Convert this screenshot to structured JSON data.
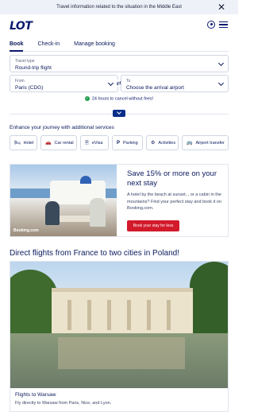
{
  "banner": {
    "message": "Travel information related to the situation in the Middle East",
    "close": "✕"
  },
  "header": {
    "logo": "LOT"
  },
  "tabs": [
    "Book",
    "Check-in",
    "Manage booking"
  ],
  "form": {
    "travel_type": {
      "label": "Travel type",
      "value": "Round-trip flight"
    },
    "from": {
      "label": "From",
      "value": "Paris (CDG)"
    },
    "to": {
      "label": "To",
      "value": "Choose the arrival airport"
    },
    "swap": "⇄",
    "cancel_note": "24 hours to cancel without fees!"
  },
  "services": {
    "heading": "Enhance your journey with additional services",
    "items": [
      {
        "icon": "🛏",
        "label": "Hotel"
      },
      {
        "icon": "🚗",
        "label": "Car rental"
      },
      {
        "icon": "🗎",
        "label": "eVisa"
      },
      {
        "icon": "P",
        "label": "Parking"
      },
      {
        "icon": "⚙",
        "label": "Activities"
      },
      {
        "icon": "🚌",
        "label": "Airport transfer"
      }
    ]
  },
  "promo": {
    "title": "Save 15% or more on your next stay",
    "description": "A hotel by the beach at sunset, , or a cabin in the mountains? Find your perfect stay and book it on Booking.com.",
    "button": "Book your stay for less",
    "image_credit": "Booking.com"
  },
  "direct": {
    "heading": "Direct flights from France to two cities in Poland!",
    "card_title": "Flights to Warsaw",
    "card_desc": "Fly directly to Warsaw from Paris, Nice, and Lyon."
  },
  "colors": {
    "brand": "#0a1a6e",
    "accent_red": "#d21a2b",
    "success": "#1e9b4a"
  }
}
